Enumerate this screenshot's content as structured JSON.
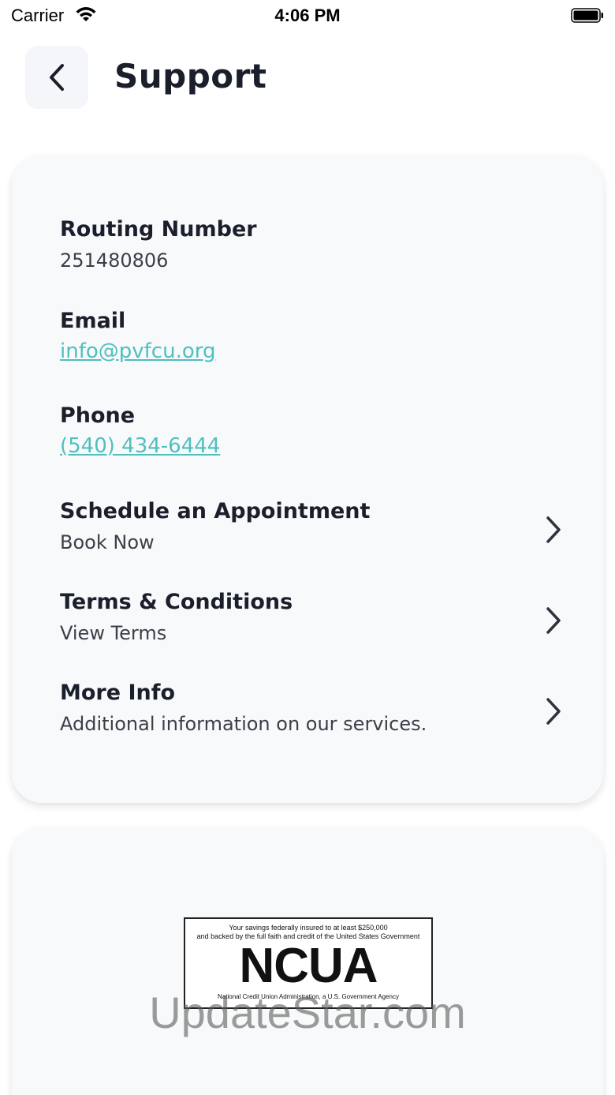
{
  "status_bar": {
    "carrier": "Carrier",
    "time": "4:06 PM",
    "icons": [
      "wifi-icon",
      "battery-icon"
    ]
  },
  "header": {
    "title": "Support",
    "back_icon": "chevron-left-icon"
  },
  "info_card": {
    "routing": {
      "title": "Routing Number",
      "value": "251480806"
    },
    "email": {
      "title": "Email",
      "value": "info@pvfcu.org"
    },
    "phone": {
      "title": "Phone",
      "value": "(540) 434-6444"
    },
    "appointment": {
      "title": "Schedule an Appointment",
      "subtitle": "Book Now",
      "icon": "chevron-right-icon"
    },
    "terms": {
      "title": "Terms & Conditions",
      "subtitle": "View Terms",
      "icon": "chevron-right-icon"
    },
    "more": {
      "title": "More Info",
      "subtitle": "Additional information on our services.",
      "icon": "chevron-right-icon"
    }
  },
  "ncua": {
    "line1": "Your savings federally insured to at least $250,000",
    "line2": "and backed by the full faith and credit of the United States Government",
    "logo": "NCUA",
    "footer": "National Credit Union Administration, a U.S. Government Agency"
  },
  "watermark": "UpdateStar.com",
  "colors": {
    "link": "#4fc0be",
    "card_bg": "#f7f9fb",
    "text": "#1a1f2b"
  }
}
